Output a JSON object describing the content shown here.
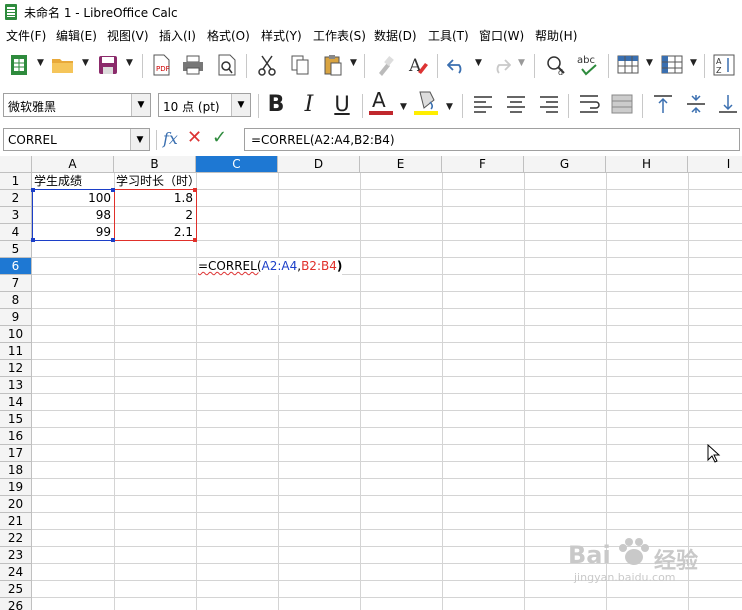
{
  "window": {
    "title": "未命名 1 - LibreOffice Calc"
  },
  "menu": [
    "文件(F)",
    "编辑(E)",
    "视图(V)",
    "插入(I)",
    "格式(O)",
    "样式(Y)",
    "工作表(S)",
    "数据(D)",
    "工具(T)",
    "窗口(W)",
    "帮助(H)"
  ],
  "toolbar": {
    "font_name": "微软雅黑",
    "font_size": "10 点 (pt)",
    "font_color": "#c0272d",
    "highlight_color": "#ffee00",
    "spell_label": "abc"
  },
  "formula_bar": {
    "name_box": "CORREL",
    "fx": "fx",
    "formula": "=CORREL(A2:A4,B2:B4)"
  },
  "sheet": {
    "columns": [
      "A",
      "B",
      "C",
      "D",
      "E",
      "F",
      "G",
      "H",
      "I"
    ],
    "rows": [
      "1",
      "2",
      "3",
      "4",
      "5",
      "6",
      "7",
      "8",
      "9",
      "10",
      "11",
      "12",
      "13",
      "14",
      "15",
      "16",
      "17",
      "18",
      "19",
      "20",
      "21",
      "22",
      "23",
      "24",
      "25",
      "26"
    ],
    "active_column": "C",
    "active_row": "6",
    "cells": {
      "A1": "学生成绩",
      "B1": "学习时长（时）",
      "A2": "100",
      "A3": "98",
      "A4": "99",
      "B2": "1.8",
      "B3": "2",
      "B4": "2.1",
      "C6_prefix": "=CORREL(",
      "C6_range1": "A2:A4",
      "C6_comma": ",",
      "C6_range2": "B2:B4",
      "C6_suffix": ")"
    },
    "range_colors": {
      "first": "#1c3fc8",
      "second": "#e0302a"
    }
  },
  "watermark": {
    "brand": "Bai",
    "du": "经验",
    "url": "jingyan.baidu.com"
  }
}
